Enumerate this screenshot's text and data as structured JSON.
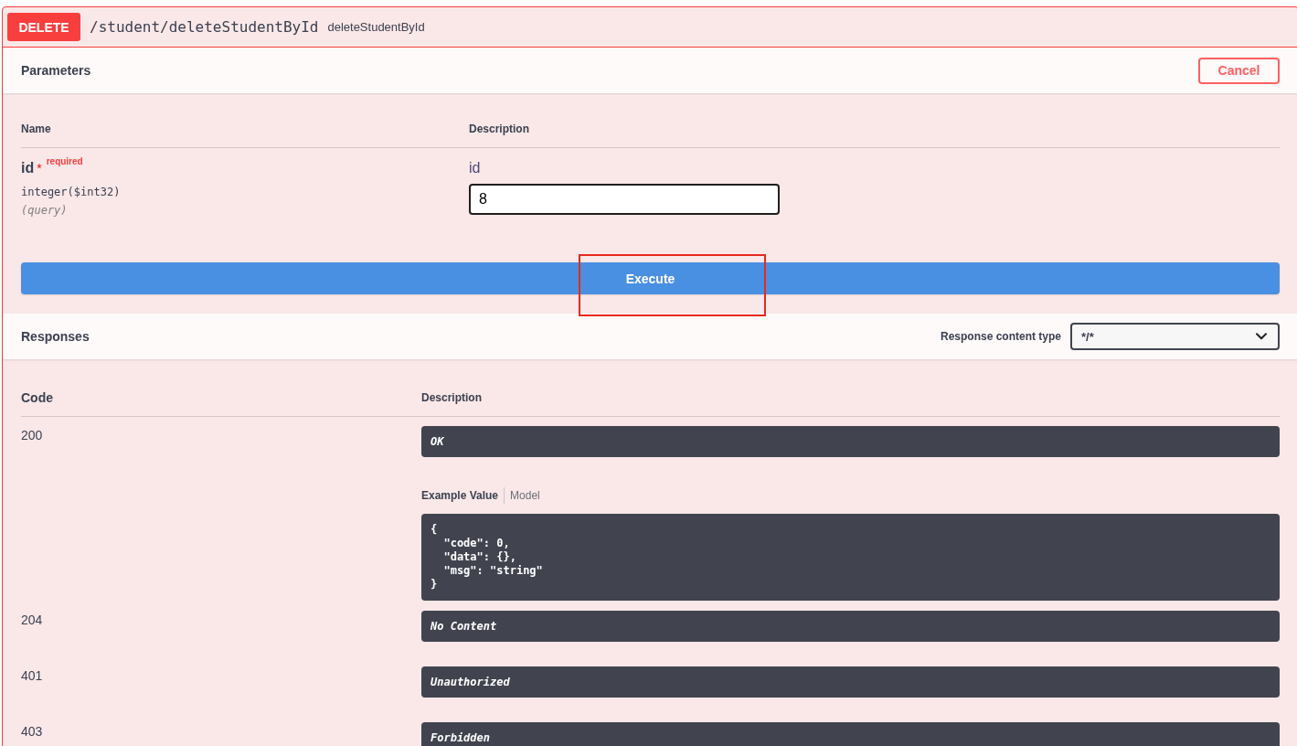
{
  "operation": {
    "method": "DELETE",
    "path": "/student/deleteStudentById",
    "summary": "deleteStudentById"
  },
  "parameters": {
    "title": "Parameters",
    "cancel_button": "Cancel",
    "columns": [
      "Name",
      "Description"
    ],
    "rows": [
      {
        "name": "id",
        "required_mark": "*",
        "required_label": "required",
        "type": "integer($int32)",
        "location": "(query)",
        "description": "id",
        "value": "8"
      }
    ],
    "execute_button": {
      "label": "Execute",
      "highlighted": true
    }
  },
  "responses": {
    "title": "Responses",
    "content_type_label": "Response content type",
    "content_type": "*/*",
    "columns": [
      "Code",
      "Description"
    ],
    "rows": [
      {
        "code": "200",
        "description": "OK",
        "example_tabs": [
          {
            "label": "Example Value",
            "selected": true
          },
          {
            "label": "Model",
            "selected": false
          }
        ],
        "example": "{\n  \"code\": 0,\n  \"data\": {},\n  \"msg\": \"string\"\n}"
      },
      {
        "code": "204",
        "description": "No Content"
      },
      {
        "code": "401",
        "description": "Unauthorized"
      },
      {
        "code": "403",
        "description": "Forbidden"
      }
    ]
  }
}
